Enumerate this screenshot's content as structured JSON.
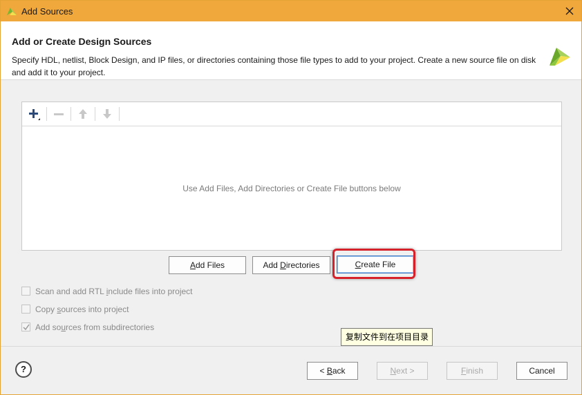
{
  "window": {
    "title": "Add Sources"
  },
  "header": {
    "title": "Add or Create Design Sources",
    "description": "Specify HDL, netlist, Block Design, and IP files, or directories containing those file types to add to your project. Create a new source file on disk and add it to your project."
  },
  "file_panel": {
    "empty_message": "Use Add Files, Add Directories or Create File buttons below"
  },
  "actions": {
    "add_files": {
      "pre": "",
      "key": "A",
      "post": "dd Files"
    },
    "add_directories": {
      "pre": "Add ",
      "key": "D",
      "post": "irectories"
    },
    "create_file": {
      "pre": "",
      "key": "C",
      "post": "reate File"
    }
  },
  "options": [
    {
      "pre": "Scan and add RTL ",
      "key": "i",
      "post": "nclude files into project",
      "checked": false
    },
    {
      "pre": "Copy ",
      "key": "s",
      "post": "ources into project",
      "checked": false
    },
    {
      "pre": "Add so",
      "key": "u",
      "post": "rces from subdirectories",
      "checked": true
    }
  ],
  "tooltip": {
    "text": "复制文件到在项目目录"
  },
  "footer": {
    "help": "?",
    "back": {
      "pre": "< ",
      "key": "B",
      "post": "ack"
    },
    "next": {
      "pre": "",
      "key": "N",
      "post": "ext >"
    },
    "finish": {
      "pre": "",
      "key": "F",
      "post": "inish"
    },
    "cancel": "Cancel"
  },
  "colors": {
    "titlebar": "#f0a73c",
    "highlight": "#d6202a",
    "logo_green": "#8dc63f",
    "logo_yellow": "#f4e04d"
  },
  "icons": {
    "title": "vivado-logo-icon",
    "close": "close-icon",
    "add": "plus-icon",
    "remove": "minus-icon",
    "up": "arrow-up-icon",
    "down": "arrow-down-icon",
    "help": "help-icon"
  }
}
